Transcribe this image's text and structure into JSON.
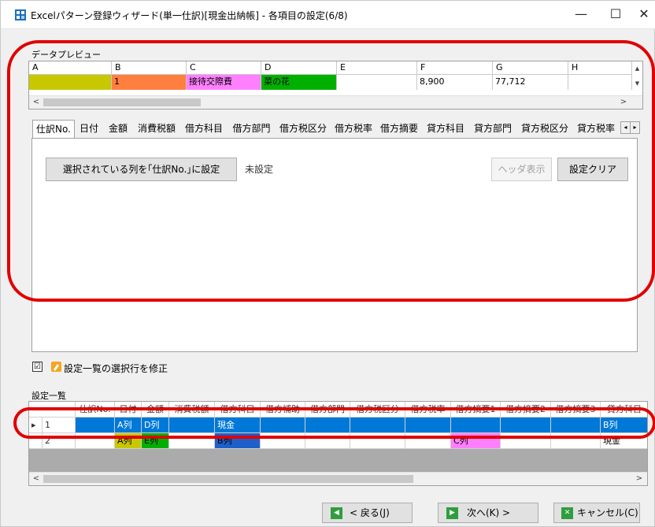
{
  "window": {
    "title": "Excelパターン登録ウィザード(単一仕訳)[現金出納帳] - 各項目の設定(6/8)",
    "minimize": "—",
    "maximize": "☐",
    "close": "✕"
  },
  "preview": {
    "label": "データプレビュー",
    "columns": [
      "A",
      "B",
      "C",
      "D",
      "E",
      "F",
      "G",
      "H"
    ],
    "row": [
      "",
      "1",
      "接待交際費",
      "菜の花",
      "",
      "8,900",
      "77,712",
      ""
    ],
    "colors": [
      "#c8c800",
      "#ff7f3f",
      "#ff80ff",
      "#00b000",
      "#ffffff",
      "#ffffff",
      "#ffffff",
      "#ffffff"
    ],
    "scroll_up": "▲",
    "scroll_down": "▼",
    "scroll_left": "<",
    "scroll_right": ">"
  },
  "tabs": [
    "仕訳No.",
    "日付",
    "金額",
    "消費税額",
    "借方科目",
    "借方部門",
    "借方税区分",
    "借方税率",
    "借方摘要",
    "貸方科目",
    "貸方部門",
    "貸方税区分",
    "貸方税率"
  ],
  "tab_scroll": [
    "◂",
    "▸"
  ],
  "panel": {
    "set_button": "選択されている列を｢仕訳No.｣に設定",
    "status": "未設定",
    "header_button": "ヘッダ表示",
    "clear_button": "設定クリア"
  },
  "modify_option": {
    "checked": "☑",
    "label": "設定一覧の選択行を修正"
  },
  "settings_list": {
    "label": "設定一覧",
    "headers": [
      "",
      "仕訳No.",
      "日付",
      "金額",
      "消費税額",
      "借方科目",
      "借方補助",
      "借方部門",
      "借方税区分",
      "借方税率",
      "借方摘要1",
      "借方摘要2",
      "借方摘要3",
      "貸方科目"
    ],
    "rows": [
      {
        "marker": "▸",
        "num": "1",
        "cells": [
          "",
          "A列",
          "D列",
          "",
          "現金",
          "",
          "",
          "",
          "",
          "",
          "",
          "",
          "B列"
        ]
      },
      {
        "marker": "",
        "num": "2",
        "cells": [
          "",
          "A列",
          "E列",
          "",
          "B列",
          "",
          "",
          "",
          "",
          "C列",
          "",
          "",
          "現金"
        ]
      }
    ],
    "scroll_left": "<",
    "scroll_right": ">"
  },
  "buttons": {
    "back": "< 戻る(J)",
    "next": "次へ(K) >",
    "cancel": "キャンセル(C)"
  },
  "colors": {
    "highlight_red": "#e00000",
    "selection_blue": "#0078d7",
    "back_icon": "#2e9e3e",
    "next_icon": "#2e9e3e",
    "cancel_icon": "#2e9e3e"
  }
}
